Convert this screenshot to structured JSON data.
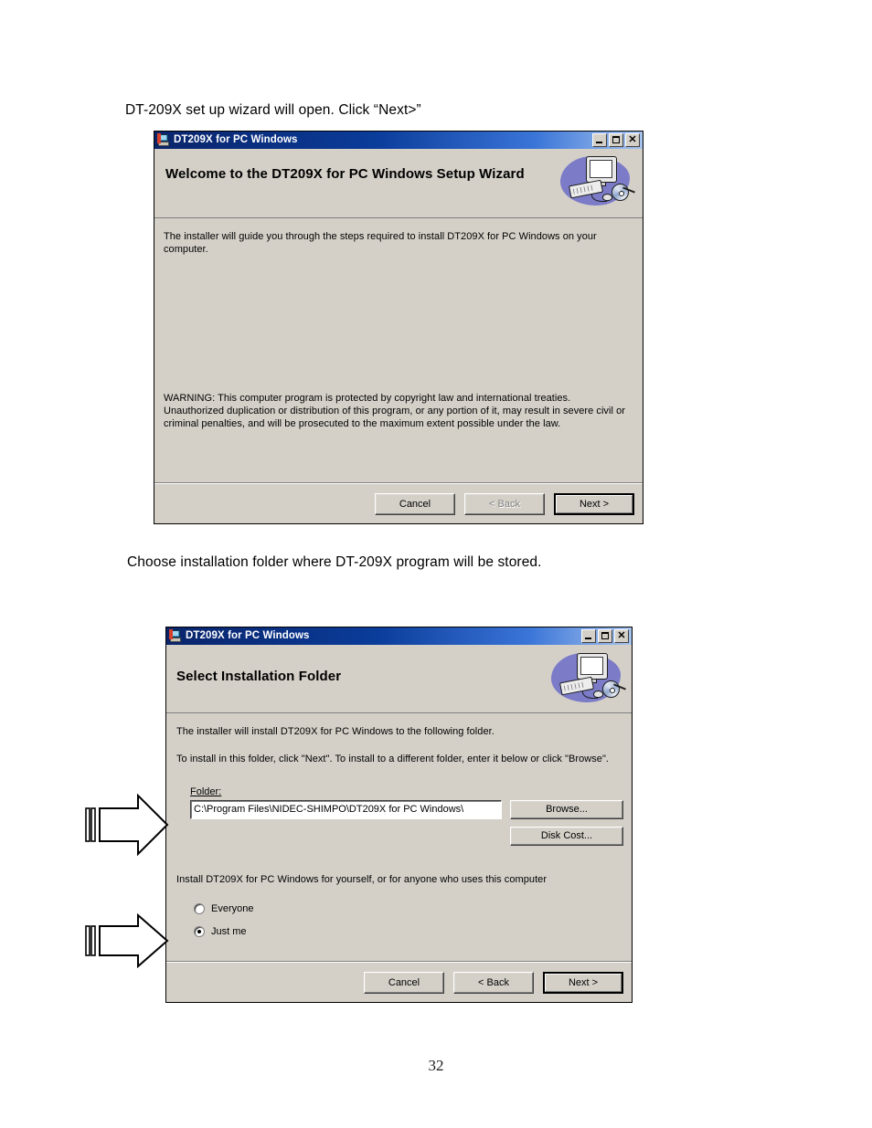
{
  "document": {
    "intro_line_1": "DT-209X set up wizard will open.  Click “Next>”",
    "intro_line_2": "Choose installation folder where DT-209X program will be stored.",
    "page_number": "32"
  },
  "dialog_welcome": {
    "titlebar": {
      "title": "DT209X for PC Windows",
      "icon": "installer-icon",
      "minimize_label": "_",
      "maximize_label": "□",
      "close_label": "✕"
    },
    "banner": {
      "heading": "Welcome to the DT209X for PC Windows Setup Wizard",
      "art": "computer-cd-art"
    },
    "body": {
      "intro": "The installer will guide you through the steps required to install DT209X for PC Windows on your computer.",
      "warning": "WARNING: This computer program is protected by copyright law and international treaties. Unauthorized duplication or distribution of this program, or any portion of it, may result in severe civil or criminal penalties, and will be prosecuted to the maximum extent possible under the law."
    },
    "buttons": {
      "cancel": "Cancel",
      "back": "< Back",
      "next": "Next >"
    }
  },
  "dialog_folder": {
    "titlebar": {
      "title": "DT209X for PC Windows",
      "icon": "installer-icon",
      "minimize_label": "_",
      "maximize_label": "□",
      "close_label": "✕"
    },
    "banner": {
      "heading": "Select Installation Folder",
      "art": "computer-cd-art"
    },
    "body": {
      "line_1": "The installer will install DT209X for PC Windows to the following folder.",
      "line_2": "To install in this folder, click \"Next\". To install to a different folder, enter it below or click \"Browse\".",
      "folder_label": "Folder:",
      "folder_value": "C:\\Program Files\\NIDEC-SHIMPO\\DT209X for PC Windows\\",
      "browse_label": "Browse...",
      "disk_cost_label": "Disk Cost...",
      "scope_prompt": "Install DT209X for PC Windows for yourself, or for anyone who uses this computer",
      "radio_everyone": "Everyone",
      "radio_just_me": "Just me",
      "selected_scope": "Just me"
    },
    "buttons": {
      "cancel": "Cancel",
      "back": "< Back",
      "next": "Next >"
    }
  },
  "annotations": {
    "arrow_folder": "pointer-arrow",
    "arrow_scope": "pointer-arrow"
  }
}
